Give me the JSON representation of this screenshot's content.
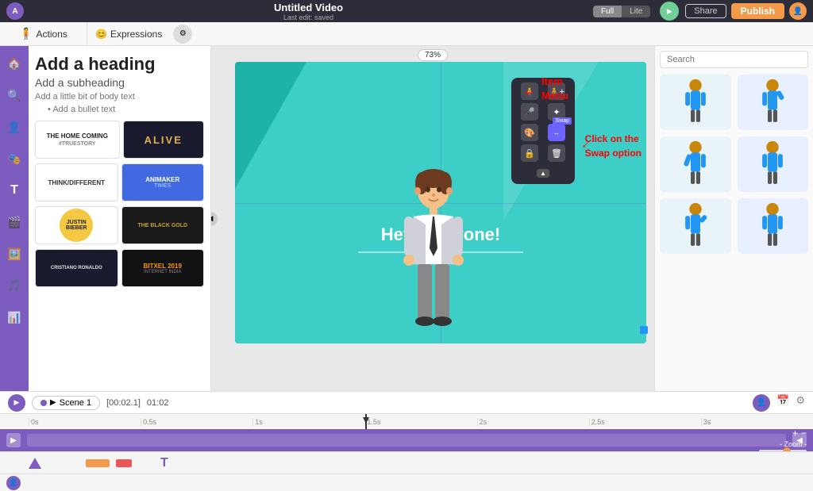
{
  "topbar": {
    "title": "Untitled Video",
    "subtitle": "Last edit: saved",
    "mode_full": "Full",
    "mode_lite": "Lite",
    "share_label": "Share",
    "publish_label": "Publish",
    "logo_text": "A"
  },
  "toolbar2": {
    "actions_label": "Actions",
    "expressions_label": "Expressions"
  },
  "zoom": "73%",
  "assets": {
    "heading": "Add a heading",
    "subheading": "Add a subheading",
    "body_text": "Add a little bit of body text",
    "bullet": "Add a bullet text",
    "items": [
      {
        "label": "THE HOME COMING",
        "sub": "#TRUESTORY",
        "style": "homecoming"
      },
      {
        "label": "ALIVE",
        "style": "alive"
      },
      {
        "label": "THINK/DIFFERENT",
        "style": "think"
      },
      {
        "label": "ANIMAKER TIMES",
        "style": "animaker"
      },
      {
        "label": "JUSTIN BIEBER",
        "style": "justin"
      },
      {
        "label": "THE BLACK GOLD",
        "style": "blackgold"
      },
      {
        "label": "CRISTIANO RONALDO",
        "style": "cristiano"
      },
      {
        "label": "BITXEL 2019",
        "sub": "INTERNET INDIA",
        "style": "bitxel"
      }
    ]
  },
  "scene": {
    "text": "Hey everyone!",
    "name": "Scene 1"
  },
  "context_menu": {
    "swap_label": "Swap"
  },
  "annotations": {
    "item_menu": "Item\nMenu",
    "swap_option": "Click on the\nSwap option"
  },
  "timeline": {
    "time_display": "[00:02.1]",
    "time_total": "01:02",
    "scene_label": "Scene 1",
    "rulers": [
      "0s",
      "0.5s",
      "1s",
      "1.5s",
      "2s",
      "2.5s",
      "3s"
    ],
    "zoom_label": "- Zoom -"
  },
  "right_panel": {
    "search_placeholder": "Search"
  },
  "sidebar_icons": [
    "🏠",
    "🔍",
    "👤",
    "🎭",
    "T",
    "🎬",
    "🖼️",
    "🎵",
    "📊"
  ]
}
